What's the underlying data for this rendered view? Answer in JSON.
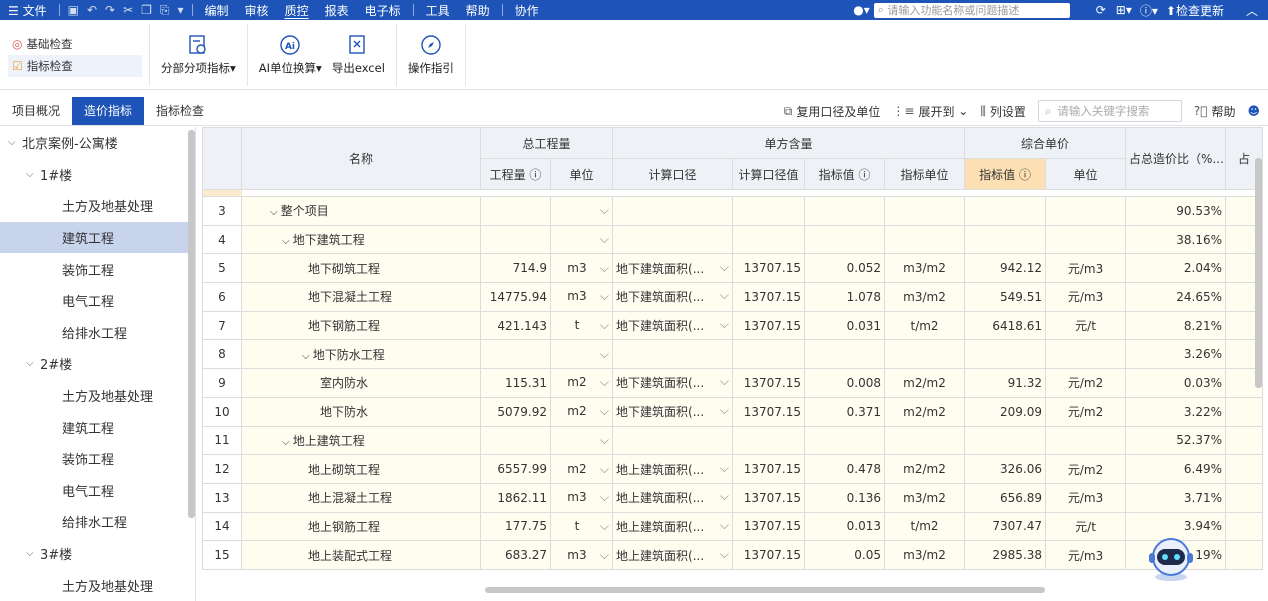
{
  "menu": {
    "file": "文件",
    "items": [
      "编制",
      "审核",
      "质控",
      "报表",
      "电子标",
      "工具",
      "帮助",
      "协作"
    ],
    "active": "质控",
    "search_placeholder": "请输入功能名称或问题描述",
    "update": "检查更新"
  },
  "ribbon": {
    "checks": [
      {
        "label": "基础检查",
        "selected": false
      },
      {
        "label": "指标检查",
        "selected": true
      }
    ],
    "buttons": {
      "sub_index": "分部分项指标",
      "ai_convert": "AI单位换算",
      "export": "导出excel",
      "guide": "操作指引"
    }
  },
  "tabs": [
    "项目概况",
    "造价指标",
    "指标检查"
  ],
  "active_tab": "造价指标",
  "tools": {
    "reuse": "复用口径及单位",
    "expand": "展开到",
    "columns": "列设置",
    "search_placeholder": "请输入关键字搜索",
    "help": "帮助"
  },
  "tree": [
    {
      "label": "北京案例-公寓楼",
      "level": 0,
      "arrow": true
    },
    {
      "label": "1#楼",
      "level": 1,
      "arrow": true
    },
    {
      "label": "土方及地基处理",
      "level": 2
    },
    {
      "label": "建筑工程",
      "level": 2,
      "selected": true
    },
    {
      "label": "装饰工程",
      "level": 2
    },
    {
      "label": "电气工程",
      "level": 2
    },
    {
      "label": "给排水工程",
      "level": 2
    },
    {
      "label": "2#楼",
      "level": 1,
      "arrow": true
    },
    {
      "label": "土方及地基处理",
      "level": 2
    },
    {
      "label": "建筑工程",
      "level": 2
    },
    {
      "label": "装饰工程",
      "level": 2
    },
    {
      "label": "电气工程",
      "level": 2
    },
    {
      "label": "给排水工程",
      "level": 2
    },
    {
      "label": "3#楼",
      "level": 1,
      "arrow": true
    },
    {
      "label": "土方及地基处理",
      "level": 2
    }
  ],
  "table": {
    "groups": {
      "name": "名称",
      "total_qty": "总工程量",
      "unit_content": "单方含量",
      "unit_price": "综合单价",
      "share": "占总造价比（%...",
      "share2": "占"
    },
    "sub": {
      "qty": "工程量",
      "qty_unit": "单位",
      "basis": "计算口径",
      "basis_val": "计算口径值",
      "idx_val": "指标值",
      "idx_unit": "指标单位",
      "price_val": "指标值",
      "price_unit": "单位"
    },
    "rows": [
      {
        "no": "3",
        "name": "整个项目",
        "level": 0,
        "arrow": true,
        "qty": "",
        "unit": "",
        "basis": "",
        "bval": "",
        "ival": "",
        "iunit": "",
        "pval": "",
        "punit": "",
        "share": "90.53%"
      },
      {
        "no": "4",
        "name": "地下建筑工程",
        "level": 1,
        "arrow": true,
        "qty": "",
        "unit": "",
        "basis": "",
        "bval": "",
        "ival": "",
        "iunit": "",
        "pval": "",
        "punit": "",
        "share": "38.16%"
      },
      {
        "no": "5",
        "name": "地下砌筑工程",
        "level": 2,
        "qty": "714.9",
        "unit": "m3",
        "basis": "地下建筑面积(...",
        "bval": "13707.15",
        "ival": "0.052",
        "iunit": "m3/m2",
        "pval": "942.12",
        "punit": "元/m3",
        "share": "2.04%"
      },
      {
        "no": "6",
        "name": "地下混凝土工程",
        "level": 2,
        "qty": "14775.94",
        "unit": "m3",
        "basis": "地下建筑面积(...",
        "bval": "13707.15",
        "ival": "1.078",
        "iunit": "m3/m2",
        "pval": "549.51",
        "punit": "元/m3",
        "share": "24.65%"
      },
      {
        "no": "7",
        "name": "地下钢筋工程",
        "level": 2,
        "qty": "421.143",
        "unit": "t",
        "basis": "地下建筑面积(...",
        "bval": "13707.15",
        "ival": "0.031",
        "iunit": "t/m2",
        "pval": "6418.61",
        "punit": "元/t",
        "share": "8.21%"
      },
      {
        "no": "8",
        "name": "地下防水工程",
        "level": 2,
        "arrow": true,
        "qty": "",
        "unit": "",
        "basis": "",
        "bval": "",
        "ival": "",
        "iunit": "",
        "pval": "",
        "punit": "",
        "share": "3.26%"
      },
      {
        "no": "9",
        "name": "室内防水",
        "level": 3,
        "qty": "115.31",
        "unit": "m2",
        "basis": "地下建筑面积(...",
        "bval": "13707.15",
        "ival": "0.008",
        "iunit": "m2/m2",
        "pval": "91.32",
        "punit": "元/m2",
        "share": "0.03%"
      },
      {
        "no": "10",
        "name": "地下防水",
        "level": 3,
        "qty": "5079.92",
        "unit": "m2",
        "basis": "地下建筑面积(...",
        "bval": "13707.15",
        "ival": "0.371",
        "iunit": "m2/m2",
        "pval": "209.09",
        "punit": "元/m2",
        "share": "3.22%"
      },
      {
        "no": "11",
        "name": "地上建筑工程",
        "level": 1,
        "arrow": true,
        "qty": "",
        "unit": "",
        "basis": "",
        "bval": "",
        "ival": "",
        "iunit": "",
        "pval": "",
        "punit": "",
        "share": "52.37%"
      },
      {
        "no": "12",
        "name": "地上砌筑工程",
        "level": 2,
        "qty": "6557.99",
        "unit": "m2",
        "basis": "地上建筑面积(...",
        "bval": "13707.15",
        "ival": "0.478",
        "iunit": "m2/m2",
        "pval": "326.06",
        "punit": "元/m2",
        "share": "6.49%"
      },
      {
        "no": "13",
        "name": "地上混凝土工程",
        "level": 2,
        "qty": "1862.11",
        "unit": "m3",
        "basis": "地上建筑面积(...",
        "bval": "13707.15",
        "ival": "0.136",
        "iunit": "m3/m2",
        "pval": "656.89",
        "punit": "元/m3",
        "share": "3.71%"
      },
      {
        "no": "14",
        "name": "地上钢筋工程",
        "level": 2,
        "qty": "177.75",
        "unit": "t",
        "basis": "地上建筑面积(...",
        "bval": "13707.15",
        "ival": "0.013",
        "iunit": "t/m2",
        "pval": "7307.47",
        "punit": "元/t",
        "share": "3.94%"
      },
      {
        "no": "15",
        "name": "地上装配式工程",
        "level": 2,
        "qty": "683.27",
        "unit": "m3",
        "basis": "地上建筑面积(...",
        "bval": "13707.15",
        "ival": "0.05",
        "iunit": "m3/m2",
        "pval": "2985.38",
        "punit": "元/m3",
        "share": "19%"
      }
    ]
  }
}
